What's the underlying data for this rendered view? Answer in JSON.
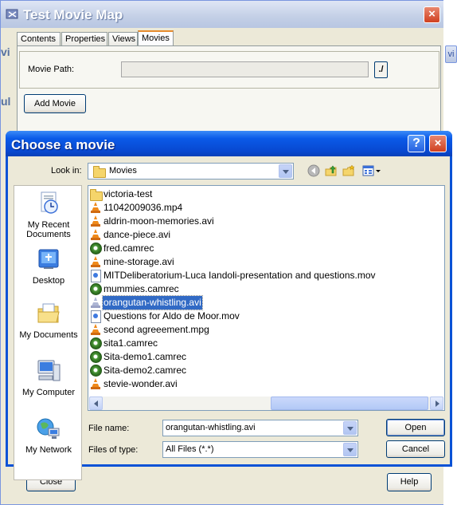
{
  "background_window": {
    "title": "Test Movie Map",
    "tabs": [
      "Contents",
      "Properties",
      "Views",
      "Movies"
    ],
    "active_tab": "Movies",
    "movie_path_label": "Movie Path:",
    "movie_path_value": "",
    "browse_label": "./",
    "add_movie_label": "Add Movie",
    "close_label": "Close",
    "help_label": "Help",
    "fragments": {
      "left1": "vi",
      "left2": "ul",
      "right1": "vi"
    }
  },
  "dialog": {
    "title": "Choose a movie",
    "help_glyph": "?",
    "close_glyph": "×",
    "look_in_label": "Look in:",
    "look_in_value": "Movies",
    "places": [
      {
        "label": "My Recent Documents",
        "icon": "recent-documents-icon"
      },
      {
        "label": "Desktop",
        "icon": "desktop-icon"
      },
      {
        "label": "My Documents",
        "icon": "my-documents-icon"
      },
      {
        "label": "My Computer",
        "icon": "my-computer-icon"
      },
      {
        "label": "My Network",
        "icon": "my-network-icon"
      }
    ],
    "files": [
      {
        "name": "victoria-test",
        "icon": "folder-icon"
      },
      {
        "name": "11042009036.mp4",
        "icon": "vlc-icon"
      },
      {
        "name": "aldrin-moon-memories.avi",
        "icon": "vlc-icon"
      },
      {
        "name": "dance-piece.avi",
        "icon": "vlc-icon"
      },
      {
        "name": "fred.camrec",
        "icon": "camtasia-icon"
      },
      {
        "name": "mine-storage.avi",
        "icon": "vlc-icon"
      },
      {
        "name": "MITDeliberatorium-Luca Iandoli-presentation and questions.mov",
        "icon": "quicktime-icon"
      },
      {
        "name": "mummies.camrec",
        "icon": "camtasia-icon"
      },
      {
        "name": "orangutan-whistling.avi",
        "icon": "vlc-icon",
        "selected": true
      },
      {
        "name": "Questions for Aldo de Moor.mov",
        "icon": "quicktime-icon"
      },
      {
        "name": "second agreeement.mpg",
        "icon": "vlc-icon"
      },
      {
        "name": "sita1.camrec",
        "icon": "camtasia-icon"
      },
      {
        "name": "Sita-demo1.camrec",
        "icon": "camtasia-icon"
      },
      {
        "name": "Sita-demo2.camrec",
        "icon": "camtasia-icon"
      },
      {
        "name": "stevie-wonder.avi",
        "icon": "vlc-icon"
      }
    ],
    "file_name_label": "File name:",
    "file_name_value": "orangutan-whistling.avi",
    "files_of_type_label": "Files of type:",
    "files_of_type_value": "All Files (*.*)",
    "open_label": "Open",
    "cancel_label": "Cancel"
  }
}
